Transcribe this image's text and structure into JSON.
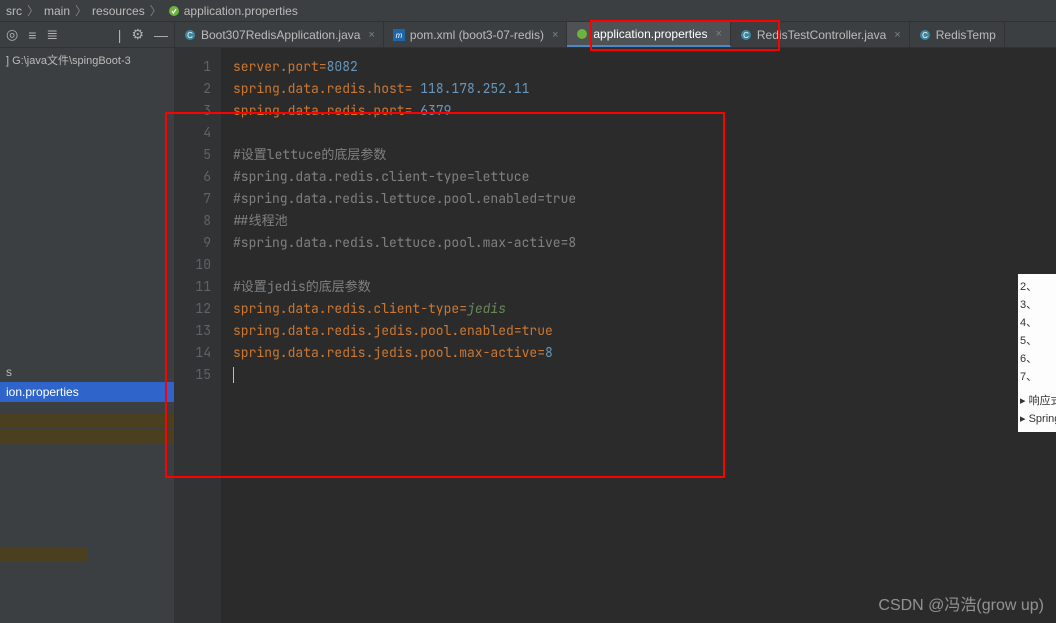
{
  "breadcrumb": {
    "items": [
      "src",
      "main",
      "resources",
      "application.properties"
    ]
  },
  "sidebar": {
    "path": "G:\\java文件\\spingBoot-3",
    "truncated_item": "s",
    "selected_item": "ion.properties"
  },
  "tabs": [
    {
      "label": "Boot307RedisApplication.java",
      "icon": "java",
      "active": false
    },
    {
      "label": "pom.xml (boot3-07-redis)",
      "icon": "maven",
      "active": false
    },
    {
      "label": "application.properties",
      "icon": "spring",
      "active": true
    },
    {
      "label": "RedisTestController.java",
      "icon": "java",
      "active": false
    },
    {
      "label": "RedisTemp",
      "icon": "java",
      "active": false
    }
  ],
  "editor": {
    "lines": [
      {
        "n": 1,
        "segments": [
          {
            "t": "server.port",
            "c": "k"
          },
          {
            "t": "=",
            "c": "eq"
          },
          {
            "t": "8082",
            "c": "num"
          }
        ]
      },
      {
        "n": 2,
        "segments": [
          {
            "t": "spring.data.redis.host",
            "c": "k"
          },
          {
            "t": "= ",
            "c": "eq"
          },
          {
            "t": "118.178.252.11",
            "c": "num"
          }
        ]
      },
      {
        "n": 3,
        "segments": [
          {
            "t": "spring.data.redis.port",
            "c": "k"
          },
          {
            "t": "= ",
            "c": "eq"
          },
          {
            "t": "6379",
            "c": "num"
          }
        ]
      },
      {
        "n": 4,
        "segments": []
      },
      {
        "n": 5,
        "segments": [
          {
            "t": "#设置lettuce的底层参数",
            "c": "cm"
          }
        ]
      },
      {
        "n": 6,
        "segments": [
          {
            "t": "#spring.data.redis.client-type=lettuce",
            "c": "cm"
          }
        ]
      },
      {
        "n": 7,
        "segments": [
          {
            "t": "#spring.data.redis.lettuce.pool.enabled=true",
            "c": "cm"
          }
        ]
      },
      {
        "n": 8,
        "segments": [
          {
            "t": "##线程池",
            "c": "cm"
          }
        ]
      },
      {
        "n": 9,
        "segments": [
          {
            "t": "#spring.data.redis.lettuce.pool.max-active=8",
            "c": "cm"
          }
        ]
      },
      {
        "n": 10,
        "segments": []
      },
      {
        "n": 11,
        "segments": [
          {
            "t": "#设置jedis的底层参数",
            "c": "cm"
          }
        ]
      },
      {
        "n": 12,
        "segments": [
          {
            "t": "spring.data.redis.client-type",
            "c": "k"
          },
          {
            "t": "=",
            "c": "eq"
          },
          {
            "t": "jedis",
            "c": "v"
          }
        ]
      },
      {
        "n": 13,
        "segments": [
          {
            "t": "spring.data.redis.jedis.pool.enabled",
            "c": "k"
          },
          {
            "t": "=",
            "c": "eq"
          },
          {
            "t": "true",
            "c": "k"
          }
        ]
      },
      {
        "n": 14,
        "segments": [
          {
            "t": "spring.data.redis.jedis.pool.max-active",
            "c": "k"
          },
          {
            "t": "=",
            "c": "eq"
          },
          {
            "t": "8",
            "c": "num"
          }
        ]
      },
      {
        "n": 15,
        "segments": [],
        "caret": true
      }
    ]
  },
  "right_panel": {
    "items": [
      "2、",
      "3、",
      "4、",
      "5、",
      "6、",
      "7、",
      "▸ 响应式",
      "▸ SpringB"
    ]
  },
  "watermark": "CSDN @冯浩(grow up)"
}
